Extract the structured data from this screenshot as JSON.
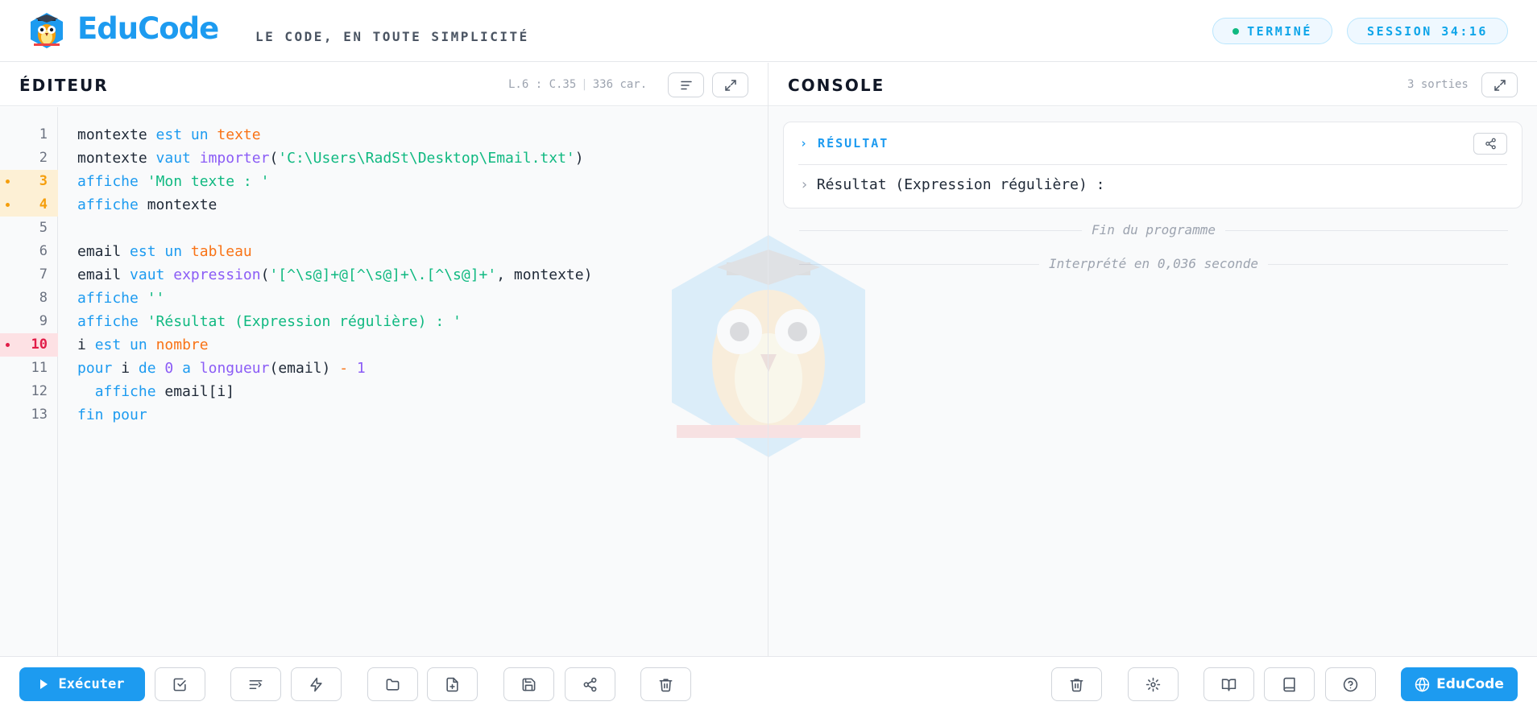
{
  "header": {
    "brand": "EduCode",
    "tagline": "LE CODE, EN TOUTE SIMPLICITÉ",
    "status": "TERMINÉ",
    "session": "SESSION 34:16",
    "status_color": "#10b981",
    "accent": "#1d9bf0"
  },
  "editor": {
    "title": "ÉDITEUR",
    "cursor": "L.6 : C.35",
    "chars": "336 car.",
    "format_icon": "align-left-icon",
    "expand_icon": "expand-icon",
    "lines": [
      {
        "n": "1",
        "marker": ""
      },
      {
        "n": "2",
        "marker": ""
      },
      {
        "n": "3",
        "marker": "warning"
      },
      {
        "n": "4",
        "marker": "warning"
      },
      {
        "n": "5",
        "marker": ""
      },
      {
        "n": "6",
        "marker": ""
      },
      {
        "n": "7",
        "marker": ""
      },
      {
        "n": "8",
        "marker": ""
      },
      {
        "n": "9",
        "marker": ""
      },
      {
        "n": "10",
        "marker": "error"
      },
      {
        "n": "11",
        "marker": ""
      },
      {
        "n": "12",
        "marker": ""
      },
      {
        "n": "13",
        "marker": ""
      }
    ],
    "code": [
      [
        {
          "t": "montexte ",
          "c": ""
        },
        {
          "t": "est un",
          "c": "kw"
        },
        {
          "t": " ",
          "c": ""
        },
        {
          "t": "texte",
          "c": "ty"
        }
      ],
      [
        {
          "t": "montexte ",
          "c": ""
        },
        {
          "t": "vaut",
          "c": "kw"
        },
        {
          "t": " ",
          "c": ""
        },
        {
          "t": "importer",
          "c": "fn"
        },
        {
          "t": "(",
          "c": ""
        },
        {
          "t": "'C:\\Users\\RadSt\\Desktop\\Email.txt'",
          "c": "str"
        },
        {
          "t": ")",
          "c": ""
        }
      ],
      [
        {
          "t": "affiche",
          "c": "kw"
        },
        {
          "t": " ",
          "c": ""
        },
        {
          "t": "'Mon texte : '",
          "c": "str"
        }
      ],
      [
        {
          "t": "affiche",
          "c": "kw"
        },
        {
          "t": " montexte",
          "c": ""
        }
      ],
      [],
      [
        {
          "t": "email ",
          "c": ""
        },
        {
          "t": "est un",
          "c": "kw"
        },
        {
          "t": " ",
          "c": ""
        },
        {
          "t": "tableau",
          "c": "ty"
        }
      ],
      [
        {
          "t": "email ",
          "c": ""
        },
        {
          "t": "vaut",
          "c": "kw"
        },
        {
          "t": " ",
          "c": ""
        },
        {
          "t": "expression",
          "c": "fn"
        },
        {
          "t": "(",
          "c": ""
        },
        {
          "t": "'[^\\s@]+@[^\\s@]+\\.[^\\s@]+'",
          "c": "str"
        },
        {
          "t": ", montexte)",
          "c": ""
        }
      ],
      [
        {
          "t": "affiche",
          "c": "kw"
        },
        {
          "t": " ",
          "c": ""
        },
        {
          "t": "''",
          "c": "str"
        }
      ],
      [
        {
          "t": "affiche",
          "c": "kw"
        },
        {
          "t": " ",
          "c": ""
        },
        {
          "t": "'Résultat (Expression régulière) : '",
          "c": "str"
        }
      ],
      [
        {
          "t": "i ",
          "c": ""
        },
        {
          "t": "est un",
          "c": "kw"
        },
        {
          "t": " ",
          "c": ""
        },
        {
          "t": "nombre",
          "c": "ty"
        }
      ],
      [
        {
          "t": "pour",
          "c": "kw"
        },
        {
          "t": " i ",
          "c": ""
        },
        {
          "t": "de",
          "c": "kw"
        },
        {
          "t": " ",
          "c": ""
        },
        {
          "t": "0",
          "c": "num"
        },
        {
          "t": " ",
          "c": ""
        },
        {
          "t": "a",
          "c": "kw"
        },
        {
          "t": " ",
          "c": ""
        },
        {
          "t": "longueur",
          "c": "fn"
        },
        {
          "t": "(email) ",
          "c": ""
        },
        {
          "t": "-",
          "c": "op"
        },
        {
          "t": " ",
          "c": ""
        },
        {
          "t": "1",
          "c": "num"
        }
      ],
      [
        {
          "t": "  ",
          "c": ""
        },
        {
          "t": "affiche",
          "c": "kw"
        },
        {
          "t": " email[i]",
          "c": ""
        }
      ],
      [
        {
          "t": "fin pour",
          "c": "kw"
        }
      ]
    ]
  },
  "console": {
    "title": "CONSOLE",
    "outputs": "3 sorties",
    "result_label": "› RÉSULTAT",
    "result_line": "Résultat (Expression régulière) :",
    "end_text": "Fin du programme",
    "time_text": "Interprété en 0,036 seconde"
  },
  "footer": {
    "run_label": "Exécuter",
    "edu_label": "EduCode"
  }
}
